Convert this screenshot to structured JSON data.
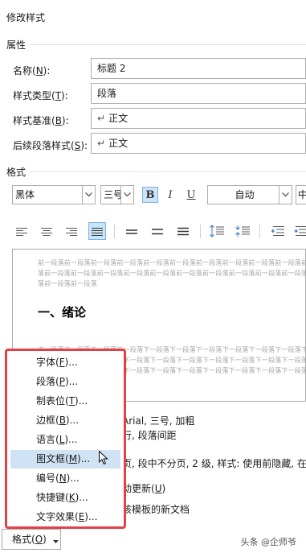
{
  "dialog": {
    "title": "修改样式"
  },
  "properties": {
    "section_label": "属性",
    "name_label": "名称(",
    "name_key": "N",
    "name_tail": "):",
    "name_value": "标题 2",
    "type_label": "样式类型(",
    "type_key": "T",
    "type_tail": "):",
    "type_value": "段落",
    "based_label": "样式基准(",
    "based_key": "B",
    "based_tail": "):",
    "based_value": "正文",
    "next_label": "后续段落样式(",
    "next_key": "S",
    "next_tail": "):",
    "next_value": "正文"
  },
  "format": {
    "section_label": "格式",
    "font": "黑体",
    "size": "三号",
    "bold": "B",
    "italic": "I",
    "underline": "U",
    "color": "自动",
    "script": "中"
  },
  "preview": {
    "prev_lines": [
      "前一段落前一段落前一段落前一段落前一段落前一段落前一段落前一段落前一段落前一段落前一段",
      "落前一段落前一段落前一段落前一段落前一段落前一段落前一段落前一段落前一段落前一段落前一段",
      "落前一段落前一段落"
    ],
    "heading": "一、绪论",
    "next_lines": [
      "下一段落下一段落下一段落下一段落下一段落下一段落下一段落下一段落下一段落下一段落下一段",
      "落下一段落下一段落下一段落下一段落下一段落下一段落下一段落下一段落下一段落下一段落下一段",
      "落下一段落下一段落下一段落下一段落下一段落下一段落下一段落下一段落下一段落下一段落下一段"
    ]
  },
  "description": {
    "line1": "Arial, 三号, 加粗",
    "line2": "行, 段落间距",
    "line3": "页, 段中不分页, 2 级, 样式: 使用前隐藏, 在样"
  },
  "options": {
    "auto_update": "动更新(",
    "auto_update_key": "U",
    "auto_update_tail": ")",
    "template": "该模板的新文档"
  },
  "menu": {
    "items": [
      {
        "label": "字体(",
        "key": "F",
        "tail": ")..."
      },
      {
        "label": "段落(",
        "key": "P",
        "tail": ")..."
      },
      {
        "label": "制表位(",
        "key": "T",
        "tail": ")..."
      },
      {
        "label": "边框(",
        "key": "B",
        "tail": ")..."
      },
      {
        "label": "语言(",
        "key": "L",
        "tail": ")..."
      },
      {
        "label": "图文框(",
        "key": "M",
        "tail": ")..."
      },
      {
        "label": "编号(",
        "key": "N",
        "tail": ")..."
      },
      {
        "label": "快捷键(",
        "key": "K",
        "tail": ")..."
      },
      {
        "label": "文字效果(",
        "key": "E",
        "tail": ")..."
      }
    ],
    "highlighted_index": 5
  },
  "format_button": {
    "label": "格式(",
    "key": "O",
    "tail": ")"
  },
  "watermark": "头条 @企师爷"
}
